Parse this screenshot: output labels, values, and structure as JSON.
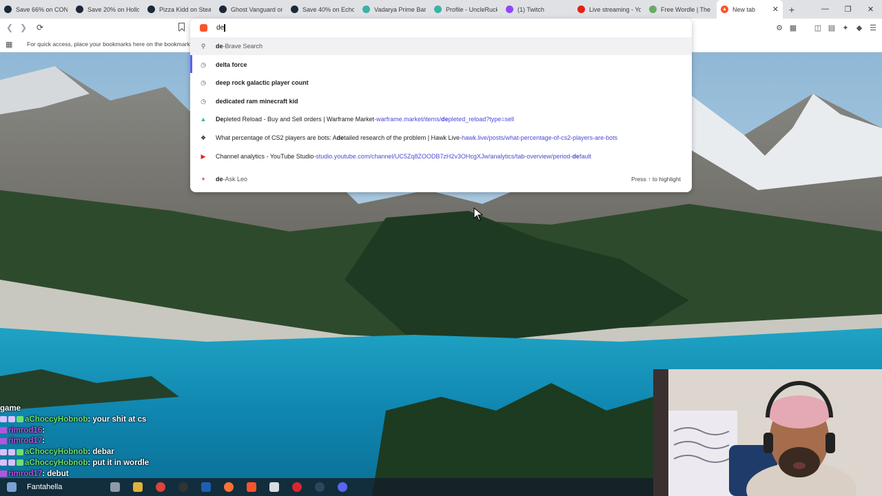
{
  "tabs": [
    {
      "label": "Save 66% on CONS",
      "favicon": "steam-icon",
      "color": "#1b2838"
    },
    {
      "label": "Save 20% on Hollo",
      "favicon": "steam-icon",
      "color": "#1b2838"
    },
    {
      "label": "Pizza Kidd on Stea",
      "favicon": "steam-icon",
      "color": "#1b2838"
    },
    {
      "label": "Ghost Vanguard on",
      "favicon": "steam-icon",
      "color": "#1b2838"
    },
    {
      "label": "Save 40% on Echo F",
      "favicon": "steam-icon",
      "color": "#1b2838"
    },
    {
      "label": "Vadarya Prime Barr",
      "favicon": "warframe-market-icon",
      "color": "#3bb2a8"
    },
    {
      "label": "Profile - UncleRuck",
      "favicon": "warframe-market-icon",
      "color": "#3bb2a8"
    },
    {
      "label": "(1) Twitch",
      "favicon": "twitch-icon",
      "color": "#9146ff"
    },
    {
      "label": "Live streaming - Yo",
      "favicon": "youtube-icon",
      "color": "#e62117"
    },
    {
      "label": "Free Wordle | The B",
      "favicon": "wordle-icon",
      "color": "#6aaa64"
    }
  ],
  "active_tab": {
    "label": "New tab",
    "favicon": "brave-icon",
    "color": "#fb542b"
  },
  "omnibox": {
    "value": "de"
  },
  "bookmarks_bar": {
    "hint": "For quick access, place your bookmarks here on the bookmarks bar"
  },
  "suggestions": [
    {
      "type": "search",
      "icon": "search-icon",
      "match": "de",
      "rest": "",
      "sep": " - ",
      "source": "Brave Search",
      "url_pre": "",
      "url_match": "",
      "url_post": ""
    },
    {
      "type": "history",
      "icon": "history-icon",
      "match": "de",
      "rest": "lta force",
      "sep": "",
      "source": "",
      "url_pre": "",
      "url_match": "",
      "url_post": ""
    },
    {
      "type": "history",
      "icon": "history-icon",
      "match": "de",
      "rest": "ep rock galactic player count",
      "sep": "",
      "source": "",
      "url_pre": "",
      "url_match": "",
      "url_post": ""
    },
    {
      "type": "history",
      "icon": "history-icon",
      "match": "de",
      "rest": "dicated ram minecraft kid",
      "sep": "",
      "source": "",
      "url_pre": "",
      "url_match": "",
      "url_post": ""
    },
    {
      "type": "page",
      "icon": "warframe-market-icon",
      "match": "De",
      "rest": "pleted Reload - Buy and Sell orders | Warframe Market",
      "sep": " - ",
      "source": "",
      "url_pre": "warframe.market/items/",
      "url_match": "de",
      "url_post": "pleted_reload?type=sell"
    },
    {
      "type": "page",
      "icon": "hawk-live-icon",
      "match": "",
      "rest": "What percentage of CS2 players are bots: A ",
      "match2": "de",
      "rest2": "tailed research of the problem | Hawk Live",
      "sep": " - ",
      "source": "",
      "url_pre": "hawk.live/posts/what-percentage-of-cs2-players-are-bots",
      "url_match": "",
      "url_post": ""
    },
    {
      "type": "page",
      "icon": "youtube-icon",
      "match": "",
      "rest": "Channel analytics - YouTube Studio",
      "sep": " - ",
      "source": "",
      "url_pre": "studio.youtube.com/channel/UC5Zq8ZOODB7zH2v3OHcgXJw/analytics/tab-overview/period-",
      "url_match": "de",
      "url_post": "fault"
    },
    {
      "type": "leo",
      "icon": "leo-icon",
      "match": "de",
      "rest": "",
      "sep": " - ",
      "source": "Ask Leo",
      "url_pre": "",
      "url_match": "",
      "url_post": "",
      "hint": "Press ↑ to highlight"
    }
  ],
  "chat": [
    {
      "nick": "",
      "msg": "game"
    },
    {
      "nick": "aChoccyHobnob",
      "msg": ": your shit at cs",
      "badges": true
    },
    {
      "nick": "rimrod16",
      "msg": ":",
      "badges": false,
      "alt": true
    },
    {
      "nick": "rimrod17",
      "msg": ":",
      "badges": false,
      "alt": true
    },
    {
      "nick": "aChoccyHobnob",
      "msg": ": debar",
      "badges": true
    },
    {
      "nick": "aChoccyHobnob",
      "msg": ": put it in wordle",
      "badges": true
    },
    {
      "nick": "rimrod17",
      "msg": ": debut",
      "badges": false,
      "alt": true
    },
    {
      "nick": "",
      "msg": "Fantahella"
    }
  ],
  "colors": {
    "accent": "#5b5ef7",
    "brave": "#fb542b",
    "url": "#4a4ad8"
  }
}
